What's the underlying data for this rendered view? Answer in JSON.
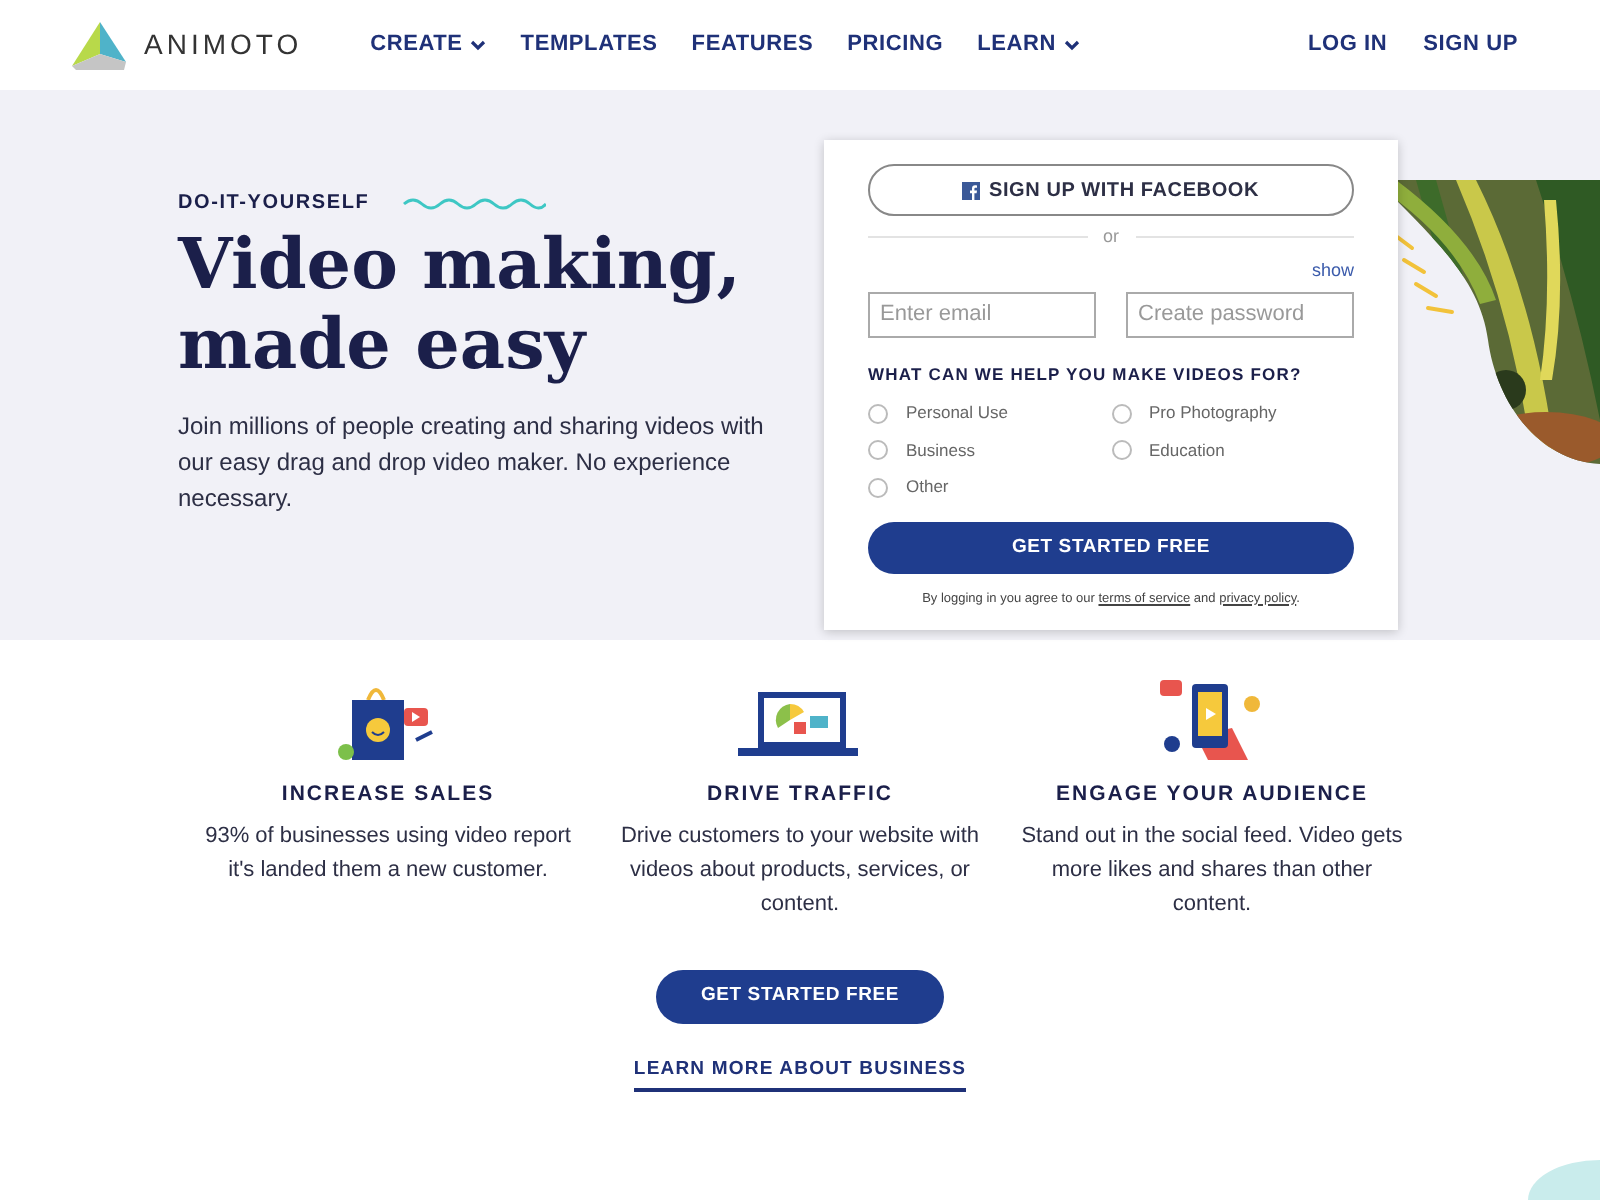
{
  "nav": {
    "logo": "ANIMOTO",
    "items": [
      {
        "label": "CREATE",
        "dropdown": true
      },
      {
        "label": "TEMPLATES",
        "dropdown": false
      },
      {
        "label": "FEATURES",
        "dropdown": false
      },
      {
        "label": "PRICING",
        "dropdown": false
      },
      {
        "label": "LEARN",
        "dropdown": true
      }
    ],
    "account": [
      "LOG IN",
      "SIGN UP"
    ]
  },
  "hero": {
    "eyebrow": "DO-IT-YOURSELF",
    "title": "Video making, made easy",
    "text": "Join millions of people creating and sharing videos with our easy drag and drop video maker. No experience necessary."
  },
  "signup": {
    "facebook_button": "SIGN UP WITH FACEBOOK",
    "divider": "or",
    "show_link": "show",
    "fields": [
      {
        "placeholder": "Enter email"
      },
      {
        "placeholder": "Create password"
      }
    ],
    "question": "WHAT CAN WE HELP YOU MAKE VIDEOS FOR?",
    "options": [
      {
        "label": "Personal Use",
        "selected": false
      },
      {
        "label": "Pro Photography",
        "selected": false
      },
      {
        "label": "Business",
        "selected": false
      },
      {
        "label": "Education",
        "selected": false
      },
      {
        "label": "Other",
        "selected": false
      }
    ],
    "submit": "GET STARTED FREE",
    "legal": [
      {
        "text": "By logging in you agree to our ",
        "link": false
      },
      {
        "text": "terms of service",
        "link": true
      },
      {
        "text": " and ",
        "link": false
      },
      {
        "text": "privacy policy",
        "link": true
      },
      {
        "text": ".",
        "link": false
      }
    ]
  },
  "features": [
    {
      "kind": "bag",
      "title": "INCREASE SALES",
      "text": "93% of businesses using video report it's landed them a new customer."
    },
    {
      "kind": "laptop",
      "title": "DRIVE TRAFFIC",
      "text": "Drive customers to your website with videos about products, services, or content."
    },
    {
      "kind": "phone",
      "title": "ENGAGE YOUR AUDIENCE",
      "text": "Stand out in the social feed. Video gets more likes and shares than other content."
    }
  ],
  "cta": "GET STARTED FREE",
  "learn_more": "LEARN MORE ABOUT BUSINESS"
}
